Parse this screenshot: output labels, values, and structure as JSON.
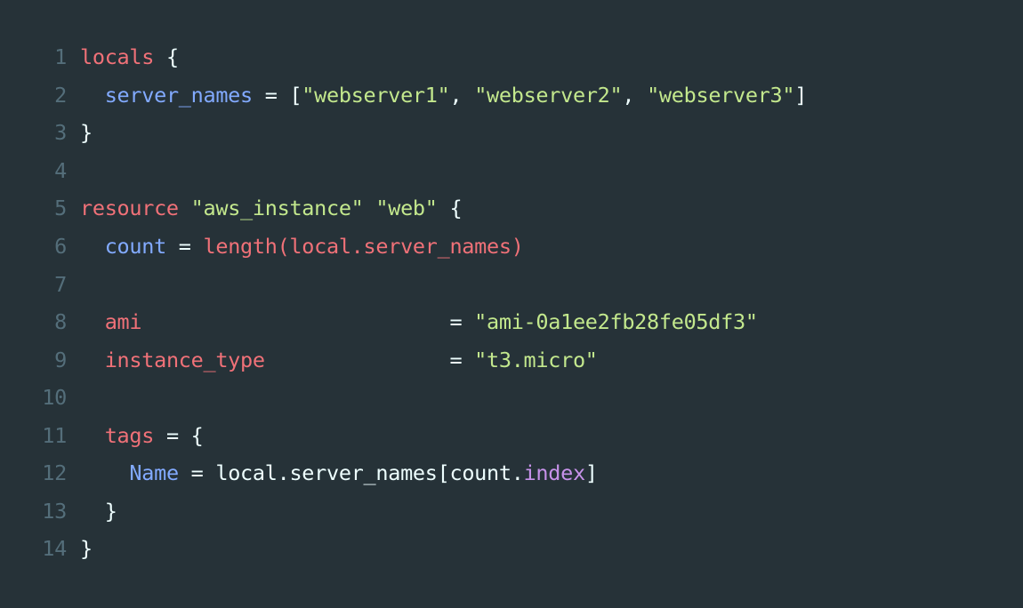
{
  "line_numbers": [
    "1",
    "2",
    "3",
    "4",
    "5",
    "6",
    "7",
    "8",
    "9",
    "10",
    "11",
    "12",
    "13",
    "14"
  ],
  "tokens": {
    "l1": {
      "kw": "locals",
      "sp": " ",
      "brace": "{"
    },
    "l2": {
      "indent": "  ",
      "prop": "server_names",
      "eq": " = ",
      "open": "[",
      "s1": "\"webserver1\"",
      "c1": ", ",
      "s2": "\"webserver2\"",
      "c2": ", ",
      "s3": "\"webserver3\"",
      "close": "]"
    },
    "l3": {
      "brace": "}"
    },
    "l5": {
      "kw": "resource",
      "sp1": " ",
      "s1": "\"aws_instance\"",
      "sp2": " ",
      "s2": "\"web\"",
      "sp3": " ",
      "brace": "{"
    },
    "l6": {
      "indent": "  ",
      "prop": "count",
      "eq": " = ",
      "fn": "length(local.server_names)"
    },
    "l8": {
      "indent": "  ",
      "attr": "ami",
      "pad": "                        ",
      "eq": " = ",
      "str": "\"ami-0a1ee2fb28fe05df3\""
    },
    "l9": {
      "indent": "  ",
      "attr": "instance_type",
      "pad": "              ",
      "eq": " = ",
      "str": "\"t3.micro\""
    },
    "l11": {
      "indent": "  ",
      "attr": "tags",
      "eq": " = ",
      "brace": "{"
    },
    "l12": {
      "indent": "    ",
      "prop": "Name",
      "eq": " = ",
      "expr1": "local.server_names[count.",
      "member": "index",
      "expr2": "]"
    },
    "l13": {
      "indent": "  ",
      "brace": "}"
    },
    "l14": {
      "brace": "}"
    }
  },
  "colors": {
    "background": "#263238",
    "line_number": "#546e7a",
    "keyword": "#f07178",
    "property": "#82aaff",
    "string": "#c3e88d",
    "plain": "#eeffff",
    "member": "#c792ea"
  }
}
